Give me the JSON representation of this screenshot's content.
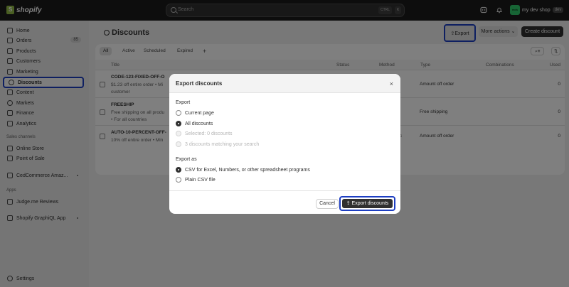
{
  "topbar": {
    "brand": "shopify",
    "search_placeholder": "Search",
    "shortcut_mod": "CTRL",
    "shortcut_key": "K",
    "store_initials": "mds",
    "store_name": "my dev shop",
    "store_tag": "dev"
  },
  "sidebar": {
    "items": [
      {
        "label": "Home",
        "icon": "home-icon"
      },
      {
        "label": "Orders",
        "icon": "orders-icon",
        "badge": "85"
      },
      {
        "label": "Products",
        "icon": "products-icon"
      },
      {
        "label": "Customers",
        "icon": "customers-icon"
      },
      {
        "label": "Marketing",
        "icon": "marketing-icon"
      },
      {
        "label": "Discounts",
        "icon": "discount-icon",
        "active": true
      },
      {
        "label": "Content",
        "icon": "content-icon"
      },
      {
        "label": "Markets",
        "icon": "globe-icon"
      },
      {
        "label": "Finance",
        "icon": "finance-icon"
      },
      {
        "label": "Analytics",
        "icon": "analytics-icon"
      }
    ],
    "sales_channels_title": "Sales channels",
    "sales_channels": [
      {
        "label": "Online Store"
      },
      {
        "label": "Point of Sale"
      }
    ],
    "app_pinned": "CedCommerce Amaz...",
    "apps_title": "Apps",
    "apps": [
      {
        "label": "Judge.me Reviews"
      }
    ],
    "app_graphiql": "Shopify GraphiQL App",
    "settings_label": "Settings"
  },
  "main": {
    "title": "Discounts",
    "export_label": "Export",
    "more_actions_label": "More actions",
    "create_label": "Create discount",
    "tabs": [
      "All",
      "Active",
      "Scheduled",
      "Expired"
    ],
    "add_tab": "+",
    "columns": {
      "title": "Title",
      "status": "Status",
      "method": "Method",
      "type": "Type",
      "combinations": "Combinations",
      "used": "Used"
    },
    "rows": [
      {
        "title": "CODE-123-FIXED-OFF-O",
        "sub1": "$1.23 off entire order • Mi",
        "sub2": "customer",
        "method": "",
        "type": "Amount off order",
        "used": "0"
      },
      {
        "title": "FREESHIP",
        "sub1": "Free shipping on all produ",
        "sub2": "• For all countries",
        "method": "",
        "type": "Free shipping",
        "used": "0"
      },
      {
        "title": "AUTO-10-PERCENT-OFF-",
        "sub1": "10% off entire order • Min",
        "sub2": "",
        "method": "c",
        "type": "Amount off order",
        "used": "0"
      }
    ]
  },
  "modal": {
    "title": "Export discounts",
    "close_glyph": "×",
    "export_group_label": "Export",
    "export_options": [
      {
        "label": "Current page",
        "checked": false,
        "disabled": false
      },
      {
        "label": "All discounts",
        "checked": true,
        "disabled": false
      },
      {
        "label": "Selected: 0 discounts",
        "checked": false,
        "disabled": true
      },
      {
        "label": "3 discounts matching your search",
        "checked": false,
        "disabled": true
      }
    ],
    "format_group_label": "Export as",
    "format_options": [
      {
        "label": "CSV for Excel, Numbers, or other spreadsheet programs",
        "checked": true
      },
      {
        "label": "Plain CSV file",
        "checked": false
      }
    ],
    "cancel_label": "Cancel",
    "confirm_label": "Export discounts"
  },
  "colors": {
    "highlight": "#1d3ec2",
    "dark_button": "#303030",
    "topbar": "#1a1a1a"
  }
}
